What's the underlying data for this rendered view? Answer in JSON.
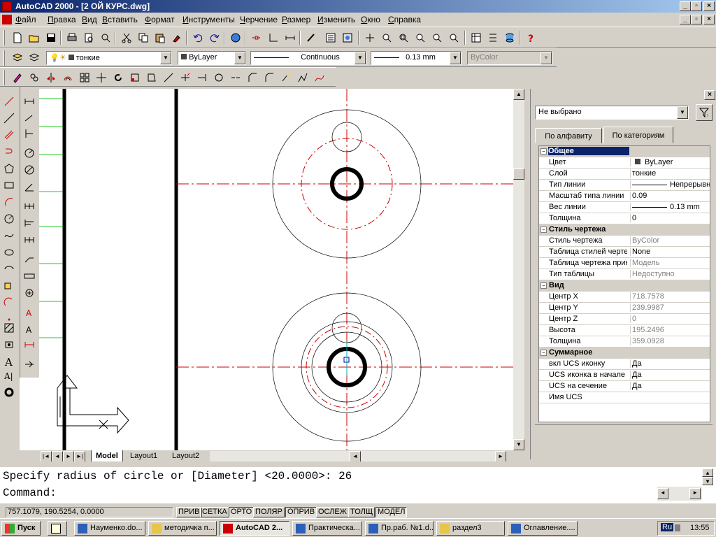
{
  "window": {
    "title": "AutoCAD 2000 - [2 ОЙ КУРС.dwg]"
  },
  "menu": [
    "Файл",
    "Правка",
    "Вид",
    "Вставить",
    "Формат",
    "Инструменты",
    "Черчение",
    "Размер",
    "Изменить",
    "Окно",
    "Справка"
  ],
  "layer_toolbar": {
    "layer": "тонкие",
    "color": "ByLayer",
    "linetype": "Continuous",
    "lineweight": "0.13 mm",
    "plotstyle": "ByColor"
  },
  "layout_tabs": [
    "Model",
    "Layout1",
    "Layout2"
  ],
  "properties": {
    "selection": "Не выбрано",
    "tabs": [
      "По алфавиту",
      "По категориям"
    ],
    "rows": [
      {
        "type": "cat",
        "k": "Общее",
        "sel": true
      },
      {
        "type": "row",
        "k": "Цвет",
        "v": "ByLayer",
        "swatch": true
      },
      {
        "type": "row",
        "k": "Слой",
        "v": "тонкие"
      },
      {
        "type": "row",
        "k": "Тип линии",
        "v": "Непрерывн",
        "line": true
      },
      {
        "type": "row",
        "k": "Масштаб типа линии",
        "v": "0.09"
      },
      {
        "type": "row",
        "k": "Вес линии",
        "v": "0.13 mm",
        "line": true
      },
      {
        "type": "row",
        "k": "Толщина",
        "v": "0"
      },
      {
        "type": "cat",
        "k": "Стиль чертежа"
      },
      {
        "type": "row",
        "k": "Стиль чертежа",
        "v": "ByColor",
        "gray": true
      },
      {
        "type": "row",
        "k": "Таблица стилей черте",
        "v": "None"
      },
      {
        "type": "row",
        "k": "Таблица чертежа прик",
        "v": "Модель",
        "gray": true
      },
      {
        "type": "row",
        "k": "Тип таблицы",
        "v": "Недоступно",
        "gray": true
      },
      {
        "type": "cat",
        "k": "Вид"
      },
      {
        "type": "row",
        "k": "Центр X",
        "v": "718.7578",
        "gray": true
      },
      {
        "type": "row",
        "k": "Центр Y",
        "v": "239.9987",
        "gray": true
      },
      {
        "type": "row",
        "k": "Центр Z",
        "v": "0",
        "gray": true
      },
      {
        "type": "row",
        "k": "Высота",
        "v": "195.2496",
        "gray": true
      },
      {
        "type": "row",
        "k": "Толщина",
        "v": "359.0928",
        "gray": true
      },
      {
        "type": "cat",
        "k": "Суммарное"
      },
      {
        "type": "row",
        "k": "вкл UCS иконку",
        "v": "Да"
      },
      {
        "type": "row",
        "k": "UCS иконка в начале к",
        "v": "Да"
      },
      {
        "type": "row",
        "k": "UCS на сечение",
        "v": "Да"
      },
      {
        "type": "row",
        "k": "Имя UCS",
        "v": ""
      }
    ]
  },
  "command": {
    "line1": "Specify radius of circle or [Diameter] <20.0000>: 26",
    "line2": "Command:"
  },
  "status": {
    "coords": "757.1079, 190.5254, 0.0000",
    "toggles": [
      {
        "label": "ПРИВ",
        "on": false
      },
      {
        "label": "СЕТКА",
        "on": false
      },
      {
        "label": "ОРТО",
        "on": true
      },
      {
        "label": "ПОЛЯР",
        "on": false
      },
      {
        "label": "ОПРИВ",
        "on": true
      },
      {
        "label": "ОСЛЕЖ",
        "on": false
      },
      {
        "label": "ТОЛЩ",
        "on": false
      },
      {
        "label": "МОДЕЛ",
        "on": true
      }
    ]
  },
  "taskbar": {
    "start": "Пуск",
    "items": [
      {
        "label": "Науменко.do...",
        "icon": "word"
      },
      {
        "label": "методичка п...",
        "icon": "folder"
      },
      {
        "label": "AutoCAD 2...",
        "icon": "acad",
        "active": true
      },
      {
        "label": "Практическа...",
        "icon": "word"
      },
      {
        "label": "Пр.раб. №1.d...",
        "icon": "word"
      },
      {
        "label": "раздел3",
        "icon": "folder"
      },
      {
        "label": "Оглавление....",
        "icon": "word"
      }
    ],
    "lang": "Ru",
    "clock": "13:55"
  },
  "colors": {
    "titlebar": "#0a246a",
    "centerline": "#cc0000",
    "selection": "#0a246a"
  }
}
